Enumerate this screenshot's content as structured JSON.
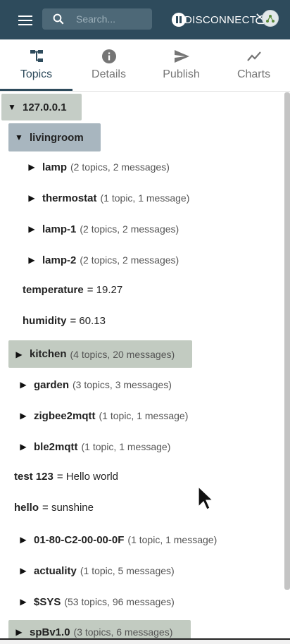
{
  "appbar": {
    "search_placeholder": "Search...",
    "disconnect_label": "DISCONNECT"
  },
  "tabs": [
    {
      "label": "Topics",
      "icon": "topics-tree-icon",
      "active": true
    },
    {
      "label": "Details",
      "icon": "info-icon",
      "active": false
    },
    {
      "label": "Publish",
      "icon": "send-icon",
      "active": false
    },
    {
      "label": "Charts",
      "icon": "chart-line-icon",
      "active": false
    }
  ],
  "tree": {
    "root": {
      "name": "127.0.0.1",
      "arrow": "▼"
    },
    "livingroom": {
      "name": "livingroom",
      "arrow": "▼"
    },
    "lamp": {
      "name": "lamp",
      "meta": "(2 topics, 2 messages)",
      "arrow": "▶"
    },
    "thermostat": {
      "name": "thermostat",
      "meta": "(1 topic, 1 message)",
      "arrow": "▶"
    },
    "lamp1": {
      "name": "lamp-1",
      "meta": "(2 topics, 2 messages)",
      "arrow": "▶"
    },
    "lamp2": {
      "name": "lamp-2",
      "meta": "(2 topics, 2 messages)",
      "arrow": "▶"
    },
    "temperature": {
      "name": "temperature",
      "value": "= 19.27"
    },
    "humidity": {
      "name": "humidity",
      "value": "= 60.13"
    },
    "kitchen": {
      "name": "kitchen",
      "meta": "(4 topics, 20 messages)",
      "arrow": "▶"
    },
    "garden": {
      "name": "garden",
      "meta": "(3 topics, 3 messages)",
      "arrow": "▶"
    },
    "zigbee": {
      "name": "zigbee2mqtt",
      "meta": "(1 topic, 1 message)",
      "arrow": "▶"
    },
    "ble": {
      "name": "ble2mqtt",
      "meta": "(1 topic, 1 message)",
      "arrow": "▶"
    },
    "test123": {
      "name": "test 123",
      "value": "= Hello world"
    },
    "hello": {
      "name": "hello",
      "value": "= sunshine"
    },
    "mac": {
      "name": "01-80-C2-00-00-0F",
      "meta": "(1 topic, 1 message)",
      "arrow": "▶"
    },
    "actuality": {
      "name": "actuality",
      "meta": "(1 topic, 5 messages)",
      "arrow": "▶"
    },
    "sys": {
      "name": "$SYS",
      "meta": "(53 topics, 96 messages)",
      "arrow": "▶"
    },
    "spbv": {
      "name": "spBv1.0",
      "meta": "(3 topics, 6 messages)",
      "arrow": "▶"
    }
  },
  "colors": {
    "appbar": "#2e4b5c",
    "highlight": "#c5cdc6",
    "selected": "#a8b6bf"
  }
}
